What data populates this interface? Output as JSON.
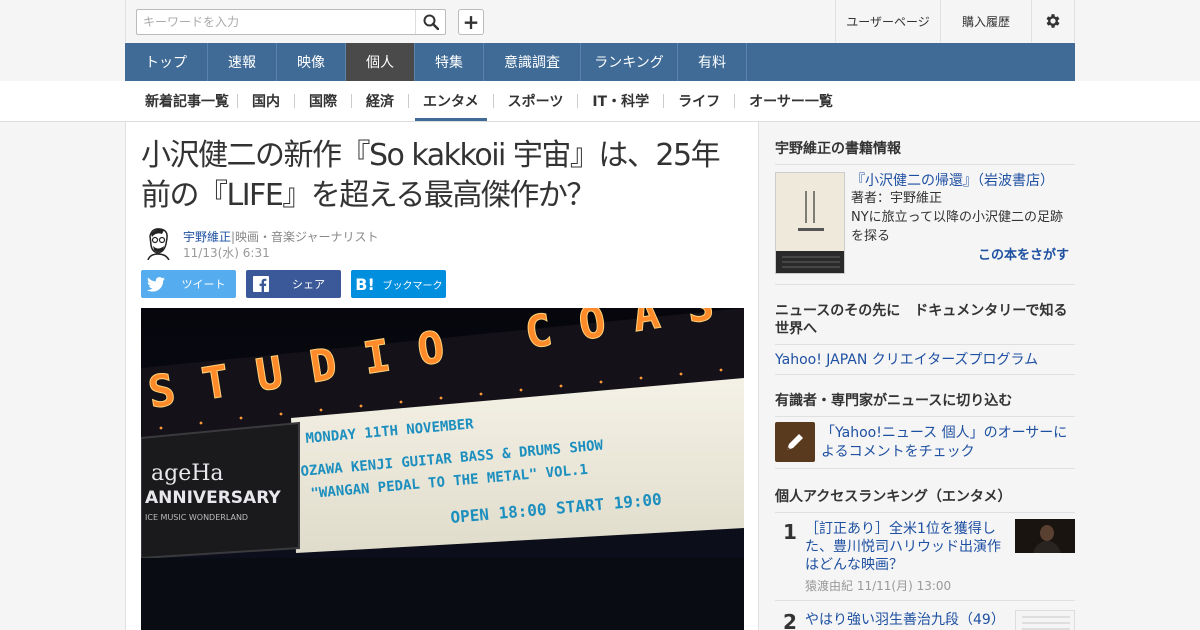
{
  "header": {
    "search_placeholder": "キーワードを入力",
    "add_label": "+",
    "links": [
      "ユーザーページ",
      "購入履歴"
    ]
  },
  "nav": {
    "items": [
      "トップ",
      "速報",
      "映像",
      "個人",
      "特集",
      "意識調査",
      "ランキング",
      "有料"
    ],
    "active": "個人"
  },
  "subnav": {
    "items": [
      "新着記事一覧",
      "国内",
      "国際",
      "経済",
      "エンタメ",
      "スポーツ",
      "IT・科学",
      "ライフ",
      "オーサー一覧"
    ],
    "active": "エンタメ"
  },
  "article": {
    "title": "小沢健二の新作『So kakkoii 宇宙』は、25年前の『LIFE』を超える最高傑作か？",
    "author": "宇野維正",
    "author_role": "|映画・音楽ジャーナリスト",
    "date": "11/13(水) 6:31",
    "share": {
      "tweet": "ツイート",
      "facebook": "シェア",
      "hatena": "ブックマーク",
      "hatena_logo": "B!"
    },
    "photo": {
      "marquee_top": "STUDIO COAST",
      "line1": "MONDAY 11TH NOVEMBER",
      "line2": "OZAWA KENJI GUITAR BASS & DRUMS SHOW",
      "line3": "\"WANGAN PEDAL TO THE METAL\" VOL.1",
      "line4": "OPEN 18:00   START 19:00",
      "sign_logo": "ageHa",
      "sign_title": "ANNIVERSARY",
      "sign_sub": "ICE MUSIC WONDERLAND"
    }
  },
  "sidebar": {
    "book_section_title": "宇野維正の書籍情報",
    "book": {
      "title": "『小沢健二の帰還』（岩波書店）",
      "author": "著者：宇野維正",
      "desc": "NYに旅立って以降の小沢健二の足跡を探る",
      "find": "この本をさがす"
    },
    "doc_title": "ニュースのその先に　ドキュメンタリーで知る世界へ",
    "doc_link": "Yahoo! JAPAN クリエイターズプログラム",
    "expert_title": "有識者・専門家がニュースに切り込む",
    "expert_link": "「Yahoo!ニュース 個人」のオーサーによるコメントをチェック",
    "ranking_title": "個人アクセスランキング（エンタメ）",
    "ranking": [
      {
        "rank": "1",
        "title": "［訂正あり］全米1位を獲得した、豊川悦司ハリウッド出演作はどんな映画？",
        "meta": "猿渡由紀  11/11(月) 13:00"
      },
      {
        "rank": "2",
        "title": "やはり強い羽生善治九段（49）",
        "meta": ""
      }
    ]
  },
  "colors": {
    "nav_bg": "#3f6b96",
    "nav_active": "#4a4a4a",
    "link": "#1e50a2",
    "twitter": "#55acee",
    "facebook": "#3b5998",
    "hatena": "#008fde"
  }
}
